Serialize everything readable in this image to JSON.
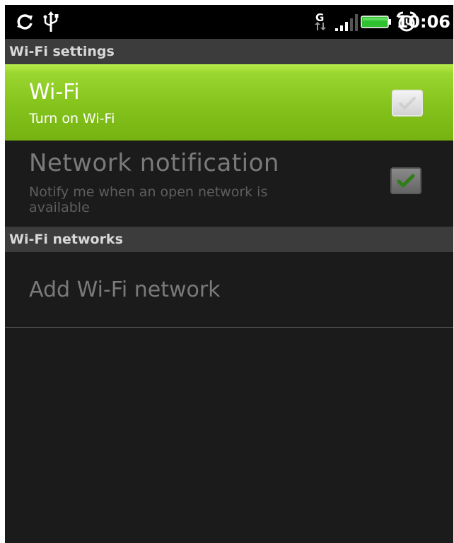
{
  "status_bar": {
    "time": "10:06",
    "icons": [
      "sync-icon",
      "usb-icon",
      "gprs-data-icon",
      "signal-icon",
      "battery-icon",
      "alarm-icon"
    ]
  },
  "sections": {
    "wifi_settings": {
      "title": "Wi-Fi settings"
    },
    "wifi_networks": {
      "title": "Wi-Fi networks"
    }
  },
  "wifi": {
    "title": "Wi-Fi",
    "summary": "Turn on Wi-Fi",
    "checked": false
  },
  "network_notification": {
    "title": "Network notification",
    "summary_line1": "Notify me when an open network is",
    "summary_line2": "available",
    "checked": true
  },
  "add_network": {
    "label": "Add Wi-Fi network"
  },
  "colors": {
    "highlight": "#8cc63f",
    "background": "#1b1b1b",
    "section_header": "#3c3c3c",
    "disabled_text": "#7a7a7a"
  }
}
